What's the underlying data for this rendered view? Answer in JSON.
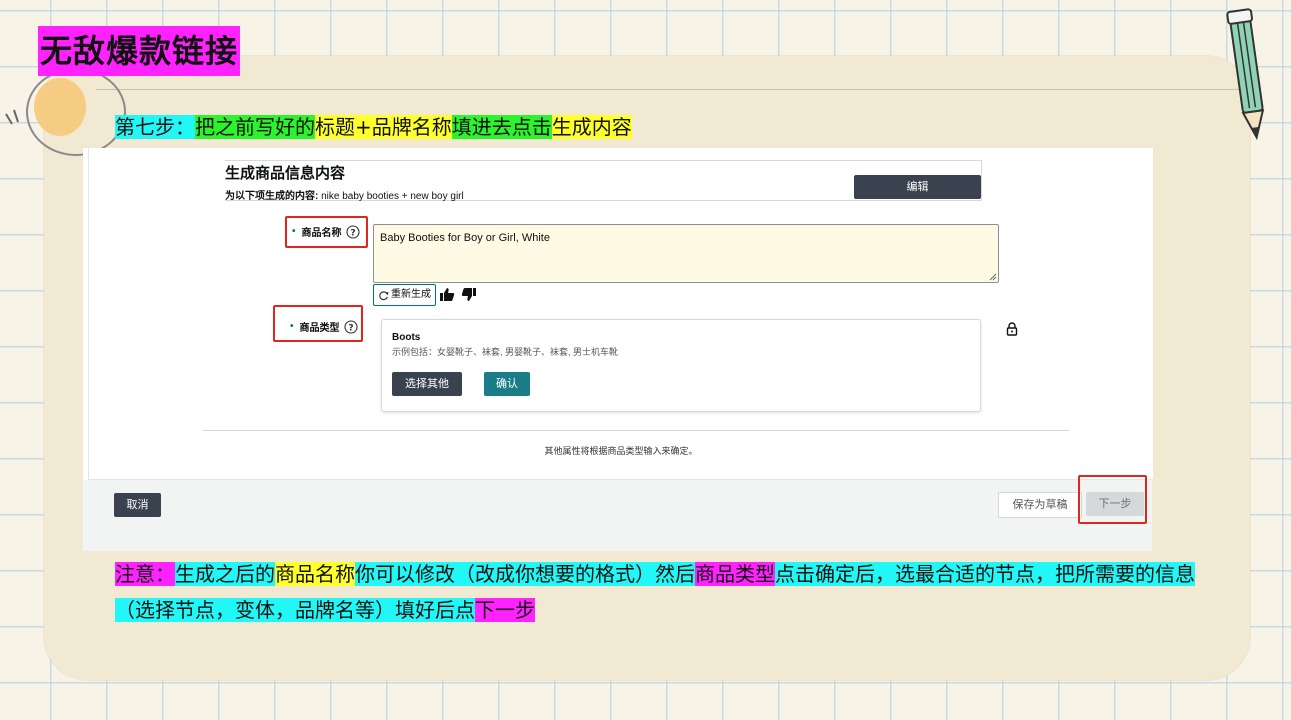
{
  "slide": {
    "title": "无敌爆款链接",
    "step_segments": [
      {
        "text": "第七步：",
        "hl": "cyan"
      },
      {
        "text": "把之前写好的",
        "hl": "green"
      },
      {
        "text": "标题+品牌名称",
        "hl": "yellow"
      },
      {
        "text": "填进去点击",
        "hl": "green"
      },
      {
        "text": "生成内容",
        "hl": "yellow"
      }
    ],
    "note_segments": [
      {
        "text": "注意：",
        "hl": "magenta"
      },
      {
        "text": "生成之后的",
        "hl": "cyan"
      },
      {
        "text": "商品名称",
        "hl": "yellow"
      },
      {
        "text": "你可以修改（改成你想要的格式）然后",
        "hl": "cyan"
      },
      {
        "text": "商品类型",
        "hl": "magenta"
      },
      {
        "text": "点击确定后，选最合适的节点，把所需要的信息（选择节点，变体，品牌名等）填好后点",
        "hl": "cyan"
      },
      {
        "text": "下一步",
        "hl": "magenta"
      }
    ]
  },
  "form": {
    "header_title": "生成商品信息内容",
    "header_sub_label": "为以下项生成的内容:",
    "header_sub_value": "nike baby booties + new boy girl",
    "edit_label": "编辑",
    "name_label": "商品名称",
    "name_value": "Baby Booties for Boy or Girl, White",
    "regen_label": "重新生成",
    "type_label": "商品类型",
    "type_name": "Boots",
    "type_examples": "示例包括：女婴靴子、袜套, 男婴靴子、袜套, 男士机车靴",
    "choose_other_label": "选择其他",
    "confirm_label": "确认",
    "attr_note": "其他属性将根据商品类型输入来确定。"
  },
  "footer": {
    "cancel_label": "取消",
    "save_draft_label": "保存为草稿",
    "next_label": "下一步"
  },
  "colors": {
    "cyan": "#21f7f7",
    "green": "#2cf42c",
    "yellow": "#ffff2c",
    "magenta": "#ff22ff",
    "red_box": "#e0261f"
  },
  "icons": [
    "help-circle-icon",
    "refresh-icon",
    "thumbs-up-icon",
    "thumbs-down-icon",
    "lock-icon",
    "pencil-icon"
  ]
}
